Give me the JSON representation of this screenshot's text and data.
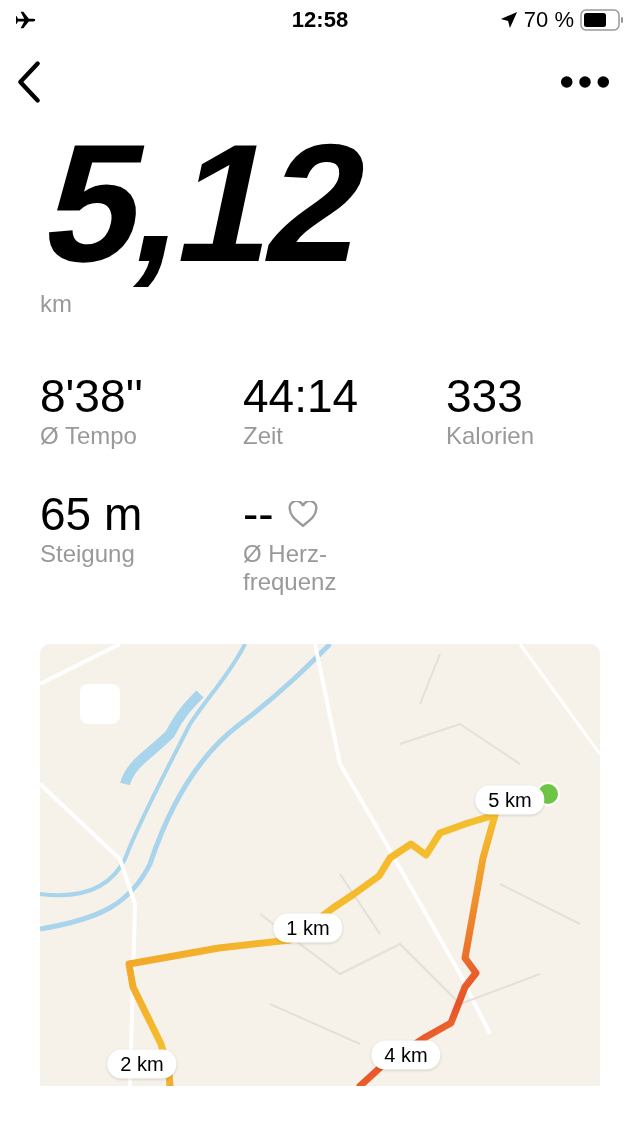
{
  "status_bar": {
    "time": "12:58",
    "battery": "70 %"
  },
  "distance": {
    "value": "5,12",
    "unit": "km"
  },
  "stats": [
    {
      "value": "8'38''",
      "label": "Ø Tempo",
      "kind": "plain"
    },
    {
      "value": "44:14",
      "label": "Zeit",
      "kind": "plain"
    },
    {
      "value": "333",
      "label": "Kalorien",
      "kind": "plain"
    },
    {
      "value": "65 m",
      "label": "Steigung",
      "kind": "plain"
    },
    {
      "value": "--",
      "label": "Ø Herz-\nfrequenz",
      "kind": "heart"
    }
  ],
  "map": {
    "kind": "picture",
    "markers": [
      {
        "label": "1 km"
      },
      {
        "label": "2 km"
      },
      {
        "label": "4 km"
      },
      {
        "label": "5 km"
      }
    ]
  }
}
